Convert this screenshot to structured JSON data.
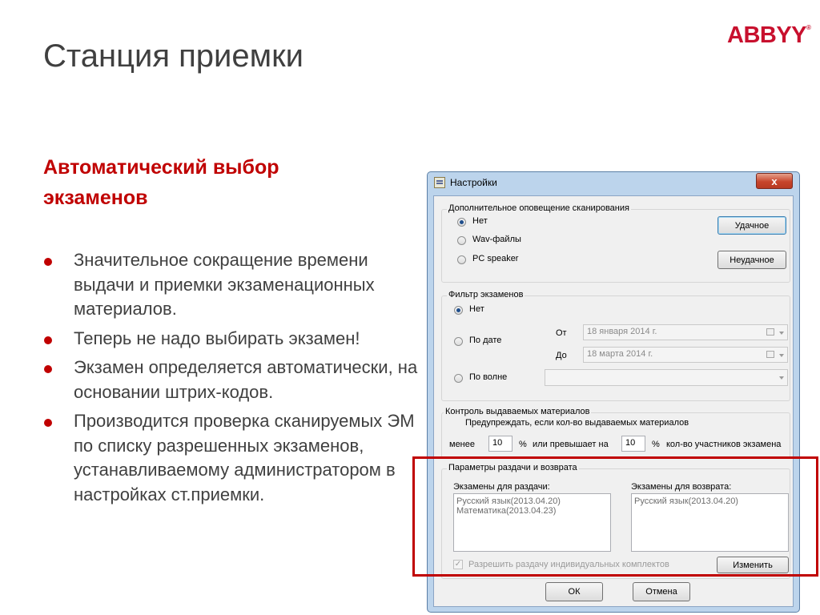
{
  "slide": {
    "title": "Станция приемки",
    "logo": "ABBYY",
    "logo_mark": "®",
    "subtitle_line1": "Автоматический выбор",
    "subtitle_line2": "экзаменов",
    "bullets": [
      "Значительное сокращение времени выдачи и приемки экзаменационных материалов.",
      "Теперь не надо выбирать экзамен!",
      "Экзамен определяется автоматически, на основании штрих-кодов.",
      "Производится проверка сканируемых ЭМ по списку разрешенных экзаменов, устанавливаемому администратором в настройках ст.приемки."
    ],
    "accent_color": "#c00000"
  },
  "dialog": {
    "title": "Настройки",
    "close_glyph": "x",
    "scan_group": {
      "legend": "Дополнительное оповещение сканирования",
      "options": [
        "Нет",
        "Wav-файлы",
        "PC speaker"
      ],
      "selected": "Нет",
      "success_button": "Удачное",
      "fail_button": "Неудачное"
    },
    "filter_group": {
      "legend": "Фильтр экзаменов",
      "options": [
        "Нет",
        "По дате",
        "По волне"
      ],
      "selected": "Нет",
      "from_label": "От",
      "to_label": "До",
      "from_value": "18  января  2014 г.",
      "to_value": "18   марта   2014 г.",
      "wave_value": ""
    },
    "control_group": {
      "legend": "Контроль выдаваемых материалов",
      "warn_text": "Предупреждать, если кол-во выдаваемых материалов",
      "less_label": "менее",
      "less_value": "10",
      "pct1": "%",
      "or_more_label": "или превышает на",
      "more_value": "10",
      "pct2": "%",
      "participants_label": "кол-во участников экзамена"
    },
    "params_group": {
      "legend": "Параметры раздачи и возврата",
      "issue_label": "Экзамены для раздачи:",
      "issue_items": [
        "Русский язык(2013.04.20)",
        "Математика(2013.04.23)"
      ],
      "return_label": "Экзамены для возврата:",
      "return_items": [
        "Русский язык(2013.04.20)"
      ],
      "allow_individual": "Разрешить раздачу индивидуальных комплектов",
      "allow_checked": true,
      "change_button": "Изменить"
    },
    "ok_button": "ОК",
    "cancel_button": "Отмена"
  }
}
